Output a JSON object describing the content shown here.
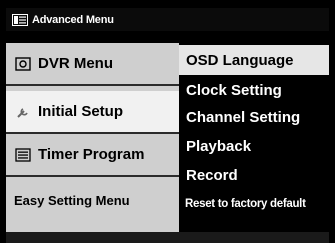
{
  "title": "Advanced Menu",
  "left_menu": [
    {
      "label": "DVR Menu",
      "icon": "dvr-icon"
    },
    {
      "label": "Initial Setup",
      "icon": "wrench-icon"
    },
    {
      "label": "Timer Program",
      "icon": "list-icon"
    },
    {
      "label": "Easy Setting Menu",
      "icon": ""
    }
  ],
  "right_menu": [
    {
      "label": "OSD Language"
    },
    {
      "label": "Clock Setting"
    },
    {
      "label": "Channel Setting"
    },
    {
      "label": "Playback"
    },
    {
      "label": "Record"
    },
    {
      "label": "Reset to factory default"
    }
  ],
  "colors": {
    "background": "#000000",
    "left_panel": "#cfcfcf",
    "selected_left": "#f1f1f1",
    "highlight_right": "#e6e6e6"
  }
}
